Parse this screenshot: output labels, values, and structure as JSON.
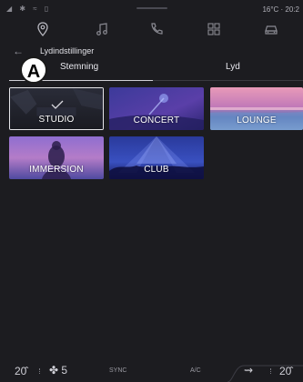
{
  "status": {
    "left_icons": "◢ ✱ ≈ ▯",
    "right_text": "16°C · 20:2"
  },
  "nav": {
    "icons": [
      "location-icon",
      "music-icon",
      "phone-icon",
      "apps-icon",
      "car-icon"
    ]
  },
  "header": {
    "back": "←",
    "title": "Lydindstillinger"
  },
  "callout": "A",
  "tabs": [
    {
      "label": "Stemning",
      "active": true
    },
    {
      "label": "Lyd",
      "active": false
    }
  ],
  "tiles": [
    {
      "label": "STUDIO",
      "selected": true
    },
    {
      "label": "CONCERT",
      "selected": false
    },
    {
      "label": "LOUNGE",
      "selected": false
    },
    {
      "label": "IMMERSION",
      "selected": false
    },
    {
      "label": "CLUB",
      "selected": false
    }
  ],
  "bottom": {
    "temp_left": "20̂",
    "fan_icon": "fan-icon",
    "fan_level": "5",
    "sync": "SYNC",
    "ac": "A/C",
    "seat_icon": "seat-heat-icon",
    "temp_right": "20̂"
  },
  "colors": {
    "background": "#1c1c20",
    "accent_text": "#e8e8ee",
    "selected_border": "#e6e6ea"
  }
}
